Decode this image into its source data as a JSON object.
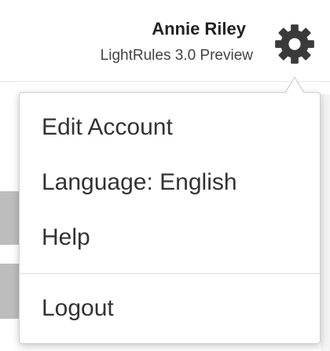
{
  "header": {
    "user_name": "Annie Riley",
    "app_version": "LightRules 3.0 Preview",
    "settings_icon": "gear-icon"
  },
  "menu": {
    "items": [
      {
        "label": "Edit Account"
      },
      {
        "label": "Language: English"
      },
      {
        "label": "Help"
      },
      {
        "label": "Logout"
      }
    ]
  },
  "colors": {
    "text_primary": "#222222",
    "text_secondary": "#444444",
    "gear": "#3a3a3a",
    "menu_border": "#cfcfcf",
    "divider": "#dddddd"
  }
}
